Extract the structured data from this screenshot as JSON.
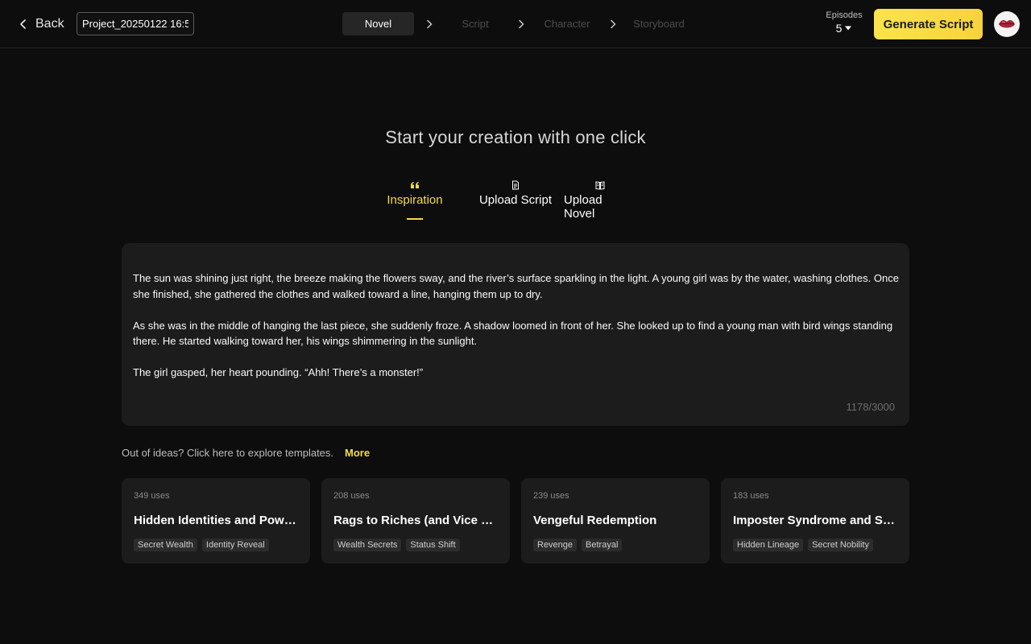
{
  "header": {
    "back_label": "Back",
    "project_name": "Project_20250122 16:5",
    "steps": [
      "Novel",
      "Script",
      "Character",
      "Storyboard"
    ],
    "episodes_label": "Episodes",
    "episodes_value": "5",
    "generate_label": "Generate Script"
  },
  "main": {
    "headline": "Start your creation with one click",
    "tabs": [
      {
        "label": "Inspiration",
        "icon": "quote-icon"
      },
      {
        "label": "Upload Script",
        "icon": "document-icon"
      },
      {
        "label": "Upload Novel",
        "icon": "book-icon"
      }
    ],
    "editor": {
      "paragraphs": [
        "The sun was shining just right, the breeze making the flowers sway, and the river’s surface sparkling in the light. A young girl was by the water, washing clothes. Once she finished, she gathered the clothes and walked toward a line, hanging them up to dry.",
        "As she was in the middle of hanging the last piece, she suddenly froze. A shadow loomed in front of her. She looked up to find a young man with bird wings standing there. He started walking toward her, his wings shimmering in the sunlight.",
        "The girl gasped, her heart pounding. “Ahh! There’s a monster!”"
      ],
      "char_count": "1178/3000"
    },
    "ideas_hint": "Out of ideas? Click here to explore templates.",
    "more_label": "More",
    "templates": [
      {
        "uses": "349 uses",
        "title": "Hidden Identities and Power Struggles",
        "tags": [
          "Secret Wealth",
          "Identity Reveal"
        ]
      },
      {
        "uses": "208 uses",
        "title": "Rags to Riches (and Vice Versa)",
        "tags": [
          "Wealth Secrets",
          "Status Shift"
        ]
      },
      {
        "uses": "239 uses",
        "title": "Vengeful Redemption",
        "tags": [
          "Revenge",
          "Betrayal"
        ]
      },
      {
        "uses": "183 uses",
        "title": "Imposter Syndrome and Secret Lineage",
        "tags": [
          "Hidden Lineage",
          "Secret Nobility"
        ]
      }
    ]
  },
  "colors": {
    "accent": "#f5dc4a",
    "background": "#0d0d0d",
    "panel": "#1c1c1c"
  }
}
